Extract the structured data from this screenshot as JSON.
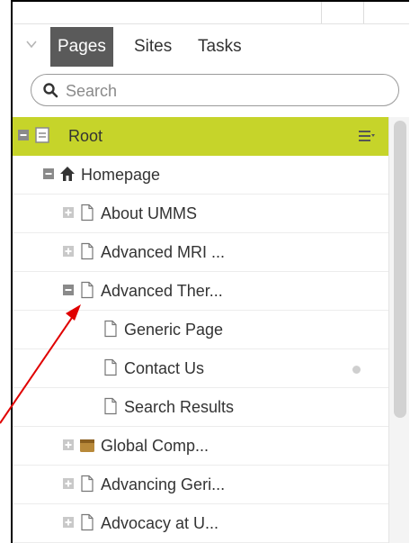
{
  "tabs": [
    {
      "label": "Pages",
      "active": true
    },
    {
      "label": "Sites",
      "active": false
    },
    {
      "label": "Tasks",
      "active": false
    }
  ],
  "search": {
    "placeholder": "Search",
    "value": ""
  },
  "tree": [
    {
      "label": "Root",
      "level": 0,
      "expander": "collapse",
      "icon": "root-page-icon",
      "selected": true
    },
    {
      "label": "Homepage",
      "level": 1,
      "expander": "collapse",
      "icon": "home-icon"
    },
    {
      "label": "About UMMS",
      "level": 2,
      "expander": "expand",
      "icon": "page-icon"
    },
    {
      "label": "Advanced MRI ...",
      "level": 2,
      "expander": "expand",
      "icon": "page-icon"
    },
    {
      "label": "Advanced Ther...",
      "level": 2,
      "expander": "collapse",
      "icon": "page-icon"
    },
    {
      "label": "Generic Page",
      "level": 3,
      "expander": "none",
      "icon": "page-icon"
    },
    {
      "label": "Contact Us",
      "level": 3,
      "expander": "none",
      "icon": "page-icon",
      "status_dot": true
    },
    {
      "label": "Search Results",
      "level": 3,
      "expander": "none",
      "icon": "page-icon"
    },
    {
      "label": "Global Comp...",
      "level": 2,
      "expander": "expand",
      "icon": "folder-icon"
    },
    {
      "label": "Advancing Geri...",
      "level": 2,
      "expander": "expand",
      "icon": "page-icon"
    },
    {
      "label": "Advocacy at U...",
      "level": 2,
      "expander": "expand",
      "icon": "page-icon"
    }
  ],
  "colors": {
    "selected_row": "#c6d42a",
    "active_tab": "#5a5a5a",
    "annotation_arrow": "#e00000"
  }
}
